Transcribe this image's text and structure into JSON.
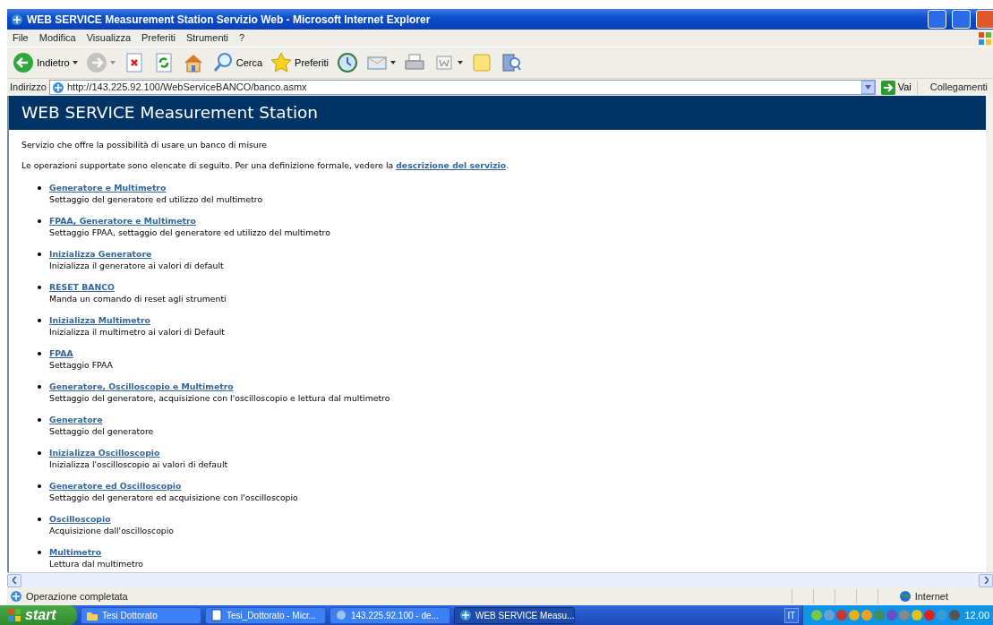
{
  "window": {
    "title": "WEB SERVICE Measurement Station Servizio Web - Microsoft Internet Explorer"
  },
  "menu": [
    "File",
    "Modifica",
    "Visualizza",
    "Preferiti",
    "Strumenti",
    "?"
  ],
  "toolbar": [
    {
      "label": "Indietro",
      "disabled": false,
      "dropdown": true
    },
    {
      "disabled": true,
      "dropdown": true
    },
    {
      "disabled": false,
      "dropdown": false
    },
    {
      "disabled": false,
      "dropdown": false
    },
    {
      "disabled": false,
      "dropdown": false
    },
    {
      "label": "Cerca",
      "disabled": false,
      "dropdown": false
    },
    {
      "label": "Preferiti",
      "disabled": false,
      "dropdown": false
    },
    {
      "disabled": false,
      "dropdown": false
    },
    {
      "disabled": false,
      "dropdown": true
    },
    {
      "disabled": false,
      "dropdown": false
    },
    {
      "disabled": false,
      "dropdown": true
    },
    {
      "disabled": false,
      "dropdown": false
    },
    {
      "disabled": false,
      "dropdown": false
    }
  ],
  "address": {
    "label": "Indirizzo",
    "value": "http://143.225.92.100/WebServiceBANCO/banco.asmx",
    "go": "Vai",
    "links": "Collegamenti"
  },
  "page": {
    "heading": "WEB SERVICE Measurement Station",
    "intro": "Servizio che offre la possibilità di usare un banco di misure",
    "sentence": {
      "before": "Le operazioni supportate sono elencate di seguito. Per una definizione formale, vedere la ",
      "link": "descrizione del servizio",
      "after": "."
    },
    "operations": [
      {
        "name": "Generatore e Multimetro",
        "description": "Settaggio del generatore ed utilizzo del multimetro"
      },
      {
        "name": "FPAA, Generatore e Multimetro",
        "description": "Settaggio FPAA, settaggio del generatore ed utilizzo del multimetro"
      },
      {
        "name": "Inizializza Generatore",
        "description": "Inizializza il generatore ai valori di default"
      },
      {
        "name": "RESET BANCO",
        "description": "Manda un comando di reset agli strumenti"
      },
      {
        "name": "Inizializza Multimetro",
        "description": "Inizializza il multimetro ai valori di Default"
      },
      {
        "name": "FPAA",
        "description": "Settaggio FPAA"
      },
      {
        "name": "Generatore, Oscilloscopio e Multimetro",
        "description": "Settaggio del generatore, acquisizione con l'oscilloscopio e lettura dal multimetro"
      },
      {
        "name": "Generatore",
        "description": "Settaggio del generatore"
      },
      {
        "name": "Inizializza Oscilloscopio",
        "description": "Inizializza l'oscilloscopio ai valori di default"
      },
      {
        "name": "Generatore ed Oscilloscopio",
        "description": "Settaggio del generatore ed acquisizione con l'oscilloscopio"
      },
      {
        "name": "Oscilloscopio",
        "description": "Acquisizione dall'oscilloscopio"
      },
      {
        "name": "Multimetro",
        "description": "Lettura dal multimetro"
      }
    ]
  },
  "status_bar": {
    "text": "Operazione completata",
    "zone": "Internet"
  },
  "taskbar": {
    "start": "start",
    "tasks": [
      {
        "label": "Tesi Dottorato",
        "selected": false
      },
      {
        "label": "Tesi_Dottorato - Micr...",
        "selected": false
      },
      {
        "label": "143.225.92.100 - de...",
        "selected": false
      },
      {
        "label": "WEB SERVICE Measu...",
        "selected": true
      }
    ],
    "language": "IT",
    "clock": "12.00"
  }
}
